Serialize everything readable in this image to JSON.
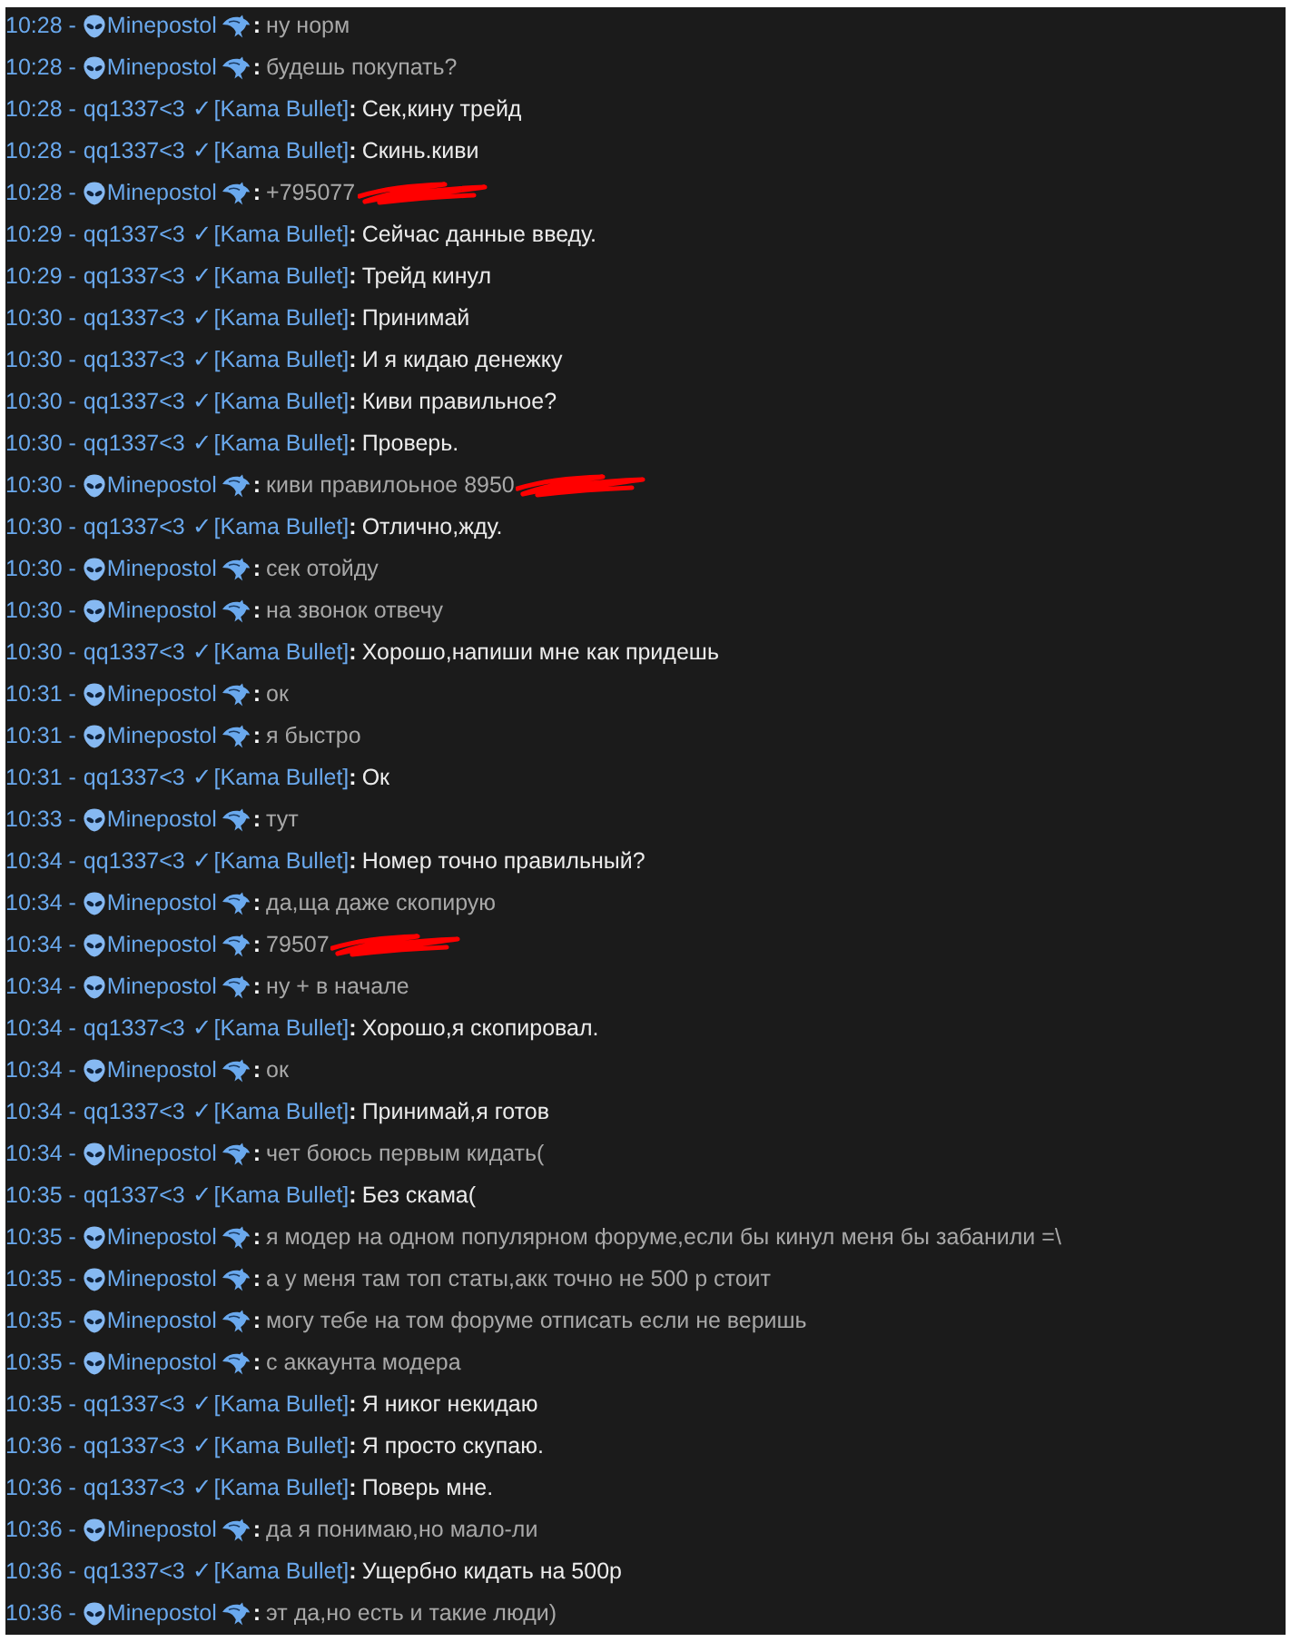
{
  "chat": {
    "messages": [
      {
        "time": "10:28",
        "separator": "-",
        "sender": "Minepostol",
        "kind": "alien",
        "colon": ":",
        "text": "ну норм",
        "redacted": false
      },
      {
        "time": "10:28",
        "separator": "-",
        "sender": "Minepostol",
        "kind": "alien",
        "colon": ":",
        "text": "будешь покупать?",
        "redacted": false
      },
      {
        "time": "10:28",
        "separator": "-",
        "sender": "qq1337<3",
        "kind": "verified",
        "badge": "✓",
        "tag": "[Kama Bullet]",
        "colon": ":",
        "text": "Сек,кину трейд",
        "redacted": false
      },
      {
        "time": "10:28",
        "separator": "-",
        "sender": "qq1337<3",
        "kind": "verified",
        "badge": "✓",
        "tag": "[Kama Bullet]",
        "colon": ":",
        "text": "Скинь.киви",
        "redacted": false
      },
      {
        "time": "10:28",
        "separator": "-",
        "sender": "Minepostol",
        "kind": "alien",
        "colon": ":",
        "text": "+795077",
        "redacted": true
      },
      {
        "time": "10:29",
        "separator": "-",
        "sender": "qq1337<3",
        "kind": "verified",
        "badge": "✓",
        "tag": "[Kama Bullet]",
        "colon": ":",
        "text": "Сейчас данные введу.",
        "redacted": false
      },
      {
        "time": "10:29",
        "separator": "-",
        "sender": "qq1337<3",
        "kind": "verified",
        "badge": "✓",
        "tag": "[Kama Bullet]",
        "colon": ":",
        "text": "Трейд кинул",
        "redacted": false
      },
      {
        "time": "10:30",
        "separator": "-",
        "sender": "qq1337<3",
        "kind": "verified",
        "badge": "✓",
        "tag": "[Kama Bullet]",
        "colon": ":",
        "text": "Принимай",
        "redacted": false
      },
      {
        "time": "10:30",
        "separator": "-",
        "sender": "qq1337<3",
        "kind": "verified",
        "badge": "✓",
        "tag": "[Kama Bullet]",
        "colon": ":",
        "text": "И я кидаю денежку",
        "redacted": false
      },
      {
        "time": "10:30",
        "separator": "-",
        "sender": "qq1337<3",
        "kind": "verified",
        "badge": "✓",
        "tag": "[Kama Bullet]",
        "colon": ":",
        "text": "Киви правильное?",
        "redacted": false
      },
      {
        "time": "10:30",
        "separator": "-",
        "sender": "qq1337<3",
        "kind": "verified",
        "badge": "✓",
        "tag": "[Kama Bullet]",
        "colon": ":",
        "text": "Проверь.",
        "redacted": false
      },
      {
        "time": "10:30",
        "separator": "-",
        "sender": "Minepostol",
        "kind": "alien",
        "colon": ":",
        "text": "киви правилоьное 8950",
        "redacted": true
      },
      {
        "time": "10:30",
        "separator": "-",
        "sender": "qq1337<3",
        "kind": "verified",
        "badge": "✓",
        "tag": "[Kama Bullet]",
        "colon": ":",
        "text": "Отлично,жду.",
        "redacted": false
      },
      {
        "time": "10:30",
        "separator": "-",
        "sender": "Minepostol",
        "kind": "alien",
        "colon": ":",
        "text": "сек отойду",
        "redacted": false
      },
      {
        "time": "10:30",
        "separator": "-",
        "sender": "Minepostol",
        "kind": "alien",
        "colon": ":",
        "text": "на звонок отвечу",
        "redacted": false
      },
      {
        "time": "10:30",
        "separator": "-",
        "sender": "qq1337<3",
        "kind": "verified",
        "badge": "✓",
        "tag": "[Kama Bullet]",
        "colon": ":",
        "text": "Хорошо,напиши мне как придешь",
        "redacted": false
      },
      {
        "time": "10:31",
        "separator": "-",
        "sender": "Minepostol",
        "kind": "alien",
        "colon": ":",
        "text": "ок",
        "redacted": false
      },
      {
        "time": "10:31",
        "separator": "-",
        "sender": "Minepostol",
        "kind": "alien",
        "colon": ":",
        "text": "я быстро",
        "redacted": false
      },
      {
        "time": "10:31",
        "separator": "-",
        "sender": "qq1337<3",
        "kind": "verified",
        "badge": "✓",
        "tag": "[Kama Bullet]",
        "colon": ":",
        "text": "Ок",
        "redacted": false
      },
      {
        "time": "10:33",
        "separator": "-",
        "sender": "Minepostol",
        "kind": "alien",
        "colon": ":",
        "text": "тут",
        "redacted": false
      },
      {
        "time": "10:34",
        "separator": "-",
        "sender": "qq1337<3",
        "kind": "verified",
        "badge": "✓",
        "tag": "[Kama Bullet]",
        "colon": ":",
        "text": "Номер точно правильный?",
        "redacted": false
      },
      {
        "time": "10:34",
        "separator": "-",
        "sender": "Minepostol",
        "kind": "alien",
        "colon": ":",
        "text": "да,ща даже скопирую",
        "redacted": false
      },
      {
        "time": "10:34",
        "separator": "-",
        "sender": "Minepostol",
        "kind": "alien",
        "colon": ":",
        "text": "79507",
        "redacted": true
      },
      {
        "time": "10:34",
        "separator": "-",
        "sender": "Minepostol",
        "kind": "alien",
        "colon": ":",
        "text": "ну + в начале",
        "redacted": false
      },
      {
        "time": "10:34",
        "separator": "-",
        "sender": "qq1337<3",
        "kind": "verified",
        "badge": "✓",
        "tag": "[Kama Bullet]",
        "colon": ":",
        "text": "Хорошо,я скопировал.",
        "redacted": false
      },
      {
        "time": "10:34",
        "separator": "-",
        "sender": "Minepostol",
        "kind": "alien",
        "colon": ":",
        "text": "ок",
        "redacted": false
      },
      {
        "time": "10:34",
        "separator": "-",
        "sender": "qq1337<3",
        "kind": "verified",
        "badge": "✓",
        "tag": "[Kama Bullet]",
        "colon": ":",
        "text": "Принимай,я готов",
        "redacted": false
      },
      {
        "time": "10:34",
        "separator": "-",
        "sender": "Minepostol",
        "kind": "alien",
        "colon": ":",
        "text": "чет боюсь первым кидать(",
        "redacted": false
      },
      {
        "time": "10:35",
        "separator": "-",
        "sender": "qq1337<3",
        "kind": "verified",
        "badge": "✓",
        "tag": "[Kama Bullet]",
        "colon": ":",
        "text": "Без скама(",
        "redacted": false
      },
      {
        "time": "10:35",
        "separator": "-",
        "sender": "Minepostol",
        "kind": "alien",
        "colon": ":",
        "text": "я модер на одном популярном форуме,если бы кинул меня бы забанили =\\",
        "redacted": false
      },
      {
        "time": "10:35",
        "separator": "-",
        "sender": "Minepostol",
        "kind": "alien",
        "colon": ":",
        "text": "а у меня там топ статы,акк точно не 500 р стоит",
        "redacted": false
      },
      {
        "time": "10:35",
        "separator": "-",
        "sender": "Minepostol",
        "kind": "alien",
        "colon": ":",
        "text": "могу тебе на том форуме отписать если не веришь",
        "redacted": false
      },
      {
        "time": "10:35",
        "separator": "-",
        "sender": "Minepostol",
        "kind": "alien",
        "colon": ":",
        "text": "с аккаунта модера",
        "redacted": false
      },
      {
        "time": "10:35",
        "separator": "-",
        "sender": "qq1337<3",
        "kind": "verified",
        "badge": "✓",
        "tag": "[Kama Bullet]",
        "colon": ":",
        "text": "Я никог некидаю",
        "redacted": false
      },
      {
        "time": "10:36",
        "separator": "-",
        "sender": "qq1337<3",
        "kind": "verified",
        "badge": "✓",
        "tag": "[Kama Bullet]",
        "colon": ":",
        "text": "Я просто скупаю.",
        "redacted": false
      },
      {
        "time": "10:36",
        "separator": "-",
        "sender": "qq1337<3",
        "kind": "verified",
        "badge": "✓",
        "tag": "[Kama Bullet]",
        "colon": ":",
        "text": "Поверь мне.",
        "redacted": false
      },
      {
        "time": "10:36",
        "separator": "-",
        "sender": "Minepostol",
        "kind": "alien",
        "colon": ":",
        "text": "да я понимаю,но мало-ли",
        "redacted": false
      },
      {
        "time": "10:36",
        "separator": "-",
        "sender": "qq1337<3",
        "kind": "verified",
        "badge": "✓",
        "tag": "[Kama Bullet]",
        "colon": ":",
        "text": "Ущербно кидать на 500р",
        "redacted": false
      },
      {
        "time": "10:36",
        "separator": "-",
        "sender": "Minepostol",
        "kind": "alien",
        "colon": ":",
        "text": "эт да,но есть и такие люди)",
        "redacted": false
      }
    ]
  }
}
